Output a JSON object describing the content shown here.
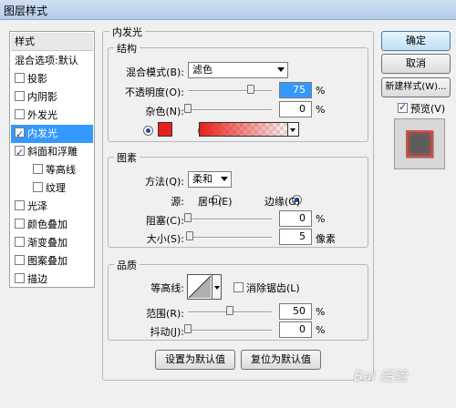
{
  "window": {
    "title": "图层样式"
  },
  "sidebar": {
    "header": "样式",
    "items": [
      {
        "label": "混合选项:默认",
        "checkbox": false,
        "checked": false,
        "selected": false
      },
      {
        "label": "投影",
        "checkbox": true,
        "checked": false,
        "selected": false
      },
      {
        "label": "内阴影",
        "checkbox": true,
        "checked": false,
        "selected": false
      },
      {
        "label": "外发光",
        "checkbox": true,
        "checked": false,
        "selected": false
      },
      {
        "label": "内发光",
        "checkbox": true,
        "checked": true,
        "selected": true
      },
      {
        "label": "斜面和浮雕",
        "checkbox": true,
        "checked": true,
        "selected": false
      },
      {
        "label": "等高线",
        "checkbox": true,
        "checked": false,
        "selected": false
      },
      {
        "label": "纹理",
        "checkbox": true,
        "checked": false,
        "selected": false
      },
      {
        "label": "光泽",
        "checkbox": true,
        "checked": false,
        "selected": false
      },
      {
        "label": "颜色叠加",
        "checkbox": true,
        "checked": false,
        "selected": false
      },
      {
        "label": "渐变叠加",
        "checkbox": true,
        "checked": false,
        "selected": false
      },
      {
        "label": "图案叠加",
        "checkbox": true,
        "checked": false,
        "selected": false
      },
      {
        "label": "描边",
        "checkbox": true,
        "checked": false,
        "selected": false
      }
    ]
  },
  "panel": {
    "title": "内发光",
    "structure": {
      "title": "结构",
      "blend_mode_label": "混合模式(B):",
      "blend_mode_value": "滤色",
      "opacity_label": "不透明度(O):",
      "opacity_value": "75",
      "opacity_unit": "%",
      "opacity_level": 0.75,
      "noise_label": "杂色(N):",
      "noise_value": "0",
      "noise_unit": "%",
      "noise_level": 0,
      "glow_color": "#e8201a"
    },
    "elements": {
      "title": "图素",
      "technique_label": "方法(Q):",
      "technique_value": "柔和",
      "source_label": "源:",
      "source_center": "居中(E)",
      "source_edge": "边缘(G)",
      "choke_label": "阻塞(C):",
      "choke_value": "0",
      "choke_unit": "%",
      "choke_level": 0,
      "size_label": "大小(S):",
      "size_value": "5",
      "size_unit": "像素",
      "size_level": 0.02
    },
    "quality": {
      "title": "品质",
      "contour_label": "等高线:",
      "antialias_label": "消除锯齿(L)",
      "range_label": "范围(R):",
      "range_value": "50",
      "range_unit": "%",
      "range_level": 0.5,
      "jitter_label": "抖动(J):",
      "jitter_value": "0",
      "jitter_unit": "%",
      "jitter_level": 0
    },
    "make_default": "设置为默认值",
    "reset_default": "复位为默认值"
  },
  "buttons": {
    "ok": "确定",
    "cancel": "取消",
    "new_style": "新建样式(W)...",
    "preview": "预览(V)"
  },
  "watermark": "Bai 经验"
}
